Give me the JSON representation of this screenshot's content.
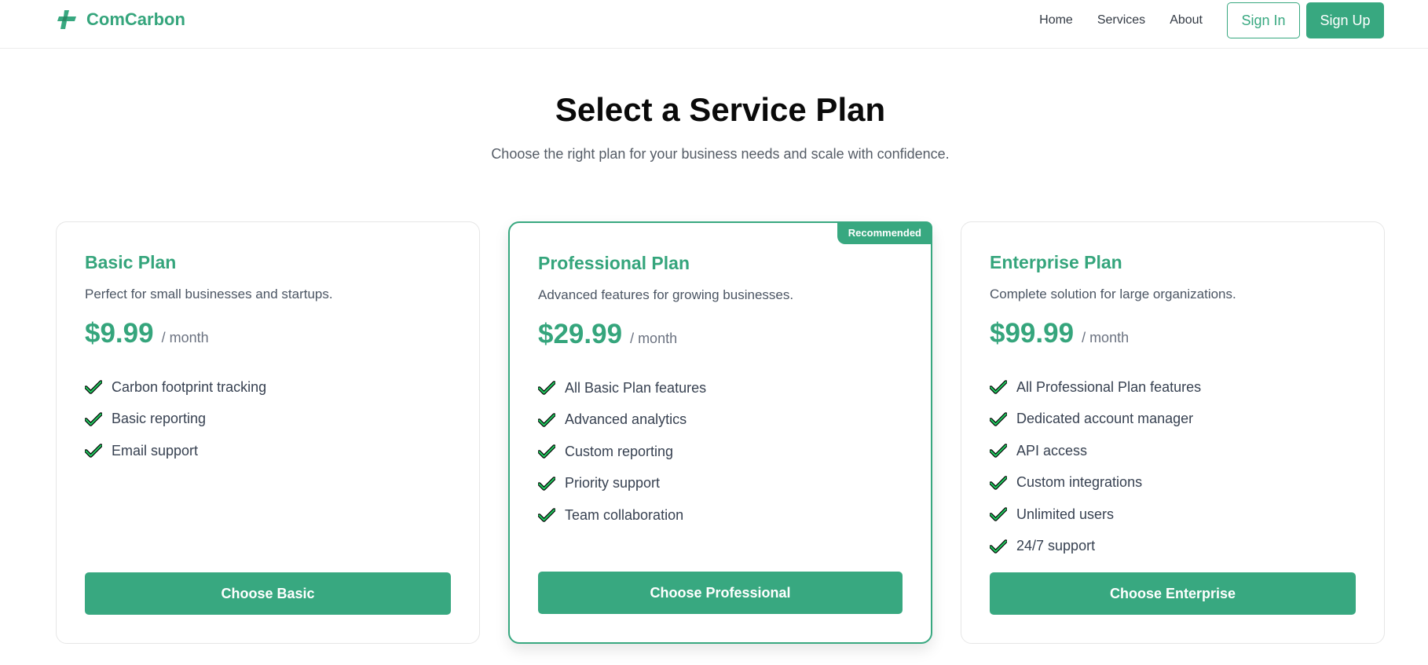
{
  "brand": {
    "name": "ComCarbon",
    "logo_icon": "leaf-cross-logo-icon",
    "accent": "#38a880"
  },
  "nav": {
    "links": [
      "Home",
      "Services",
      "About"
    ],
    "sign_in": "Sign In",
    "sign_up": "Sign Up"
  },
  "hero": {
    "title": "Select a Service Plan",
    "subtitle": "Choose the right plan for your business needs and scale with confidence."
  },
  "plans": [
    {
      "name": "Basic Plan",
      "description": "Perfect for small businesses and startups.",
      "price": "$9.99",
      "period": "/ month",
      "features": [
        "Carbon footprint tracking",
        "Basic reporting",
        "Email support"
      ],
      "cta": "Choose Basic"
    },
    {
      "name": "Professional Plan",
      "badge": "Recommended",
      "description": "Advanced features for growing businesses.",
      "price": "$29.99",
      "period": "/ month",
      "features": [
        "All Basic Plan features",
        "Advanced analytics",
        "Custom reporting",
        "Priority support",
        "Team collaboration"
      ],
      "cta": "Choose Professional"
    },
    {
      "name": "Enterprise Plan",
      "description": "Complete solution for large organizations.",
      "price": "$99.99",
      "period": "/ month",
      "features": [
        "All Professional Plan features",
        "Dedicated account manager",
        "API access",
        "Custom integrations",
        "Unlimited users",
        "24/7 support"
      ],
      "cta": "Choose Enterprise"
    }
  ],
  "icons": {
    "feature_check": "check-icon"
  }
}
